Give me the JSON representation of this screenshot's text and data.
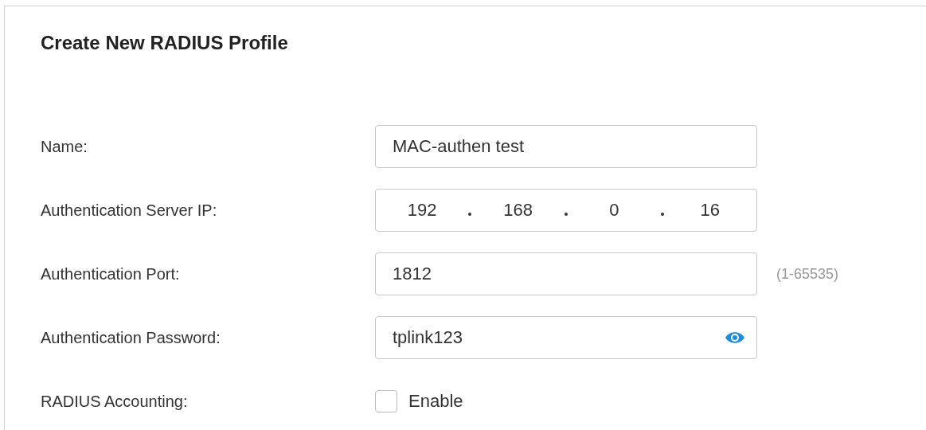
{
  "title": "Create New RADIUS Profile",
  "rows": [
    {
      "kind": "text",
      "label": "Name:",
      "value": "MAC-authen test"
    },
    {
      "kind": "ip",
      "label": "Authentication Server IP:",
      "octets": [
        "192",
        "168",
        "0",
        "16"
      ]
    },
    {
      "kind": "text",
      "label": "Authentication Port:",
      "value": "1812",
      "hint": "(1-65535)"
    },
    {
      "kind": "password",
      "label": "Authentication Password:",
      "value": "tplink123"
    },
    {
      "kind": "checkbox",
      "label": "RADIUS Accounting:",
      "option": "Enable",
      "checked": false
    }
  ]
}
